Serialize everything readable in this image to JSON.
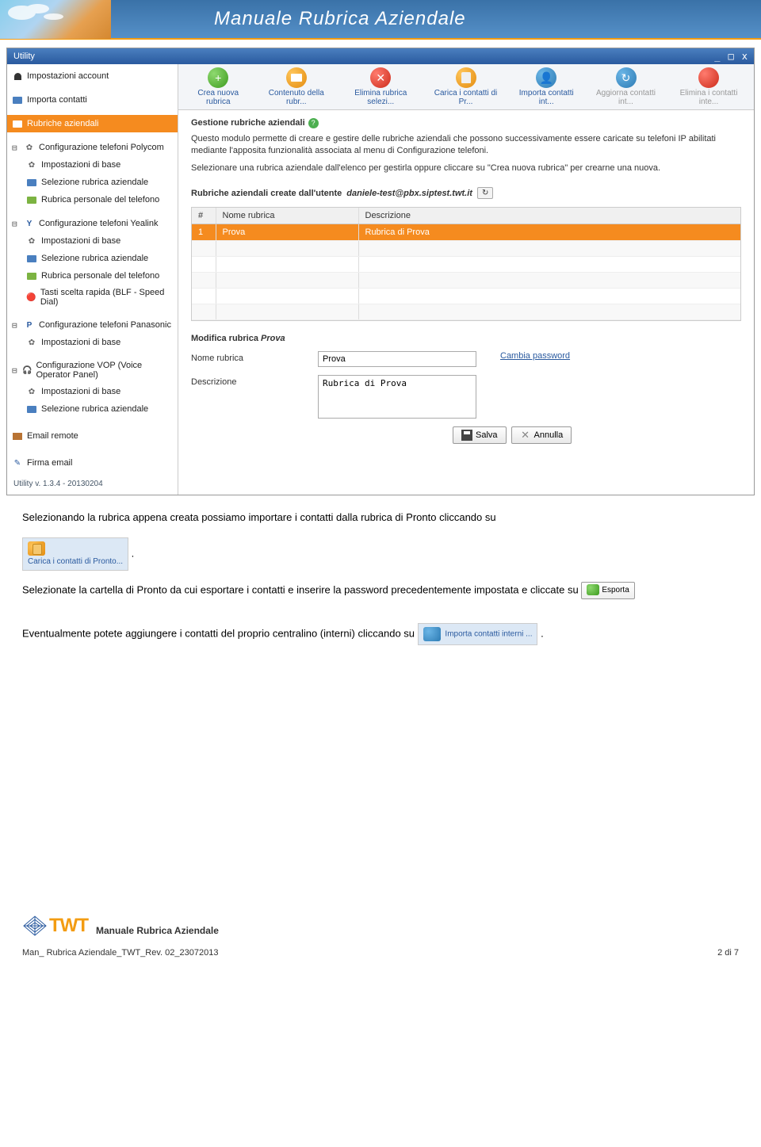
{
  "banner": {
    "title": "Manuale Rubrica Aziendale"
  },
  "window": {
    "title": "Utility",
    "buttons": {
      "min": "_",
      "max": "□",
      "close": "x"
    }
  },
  "sidebar": {
    "account": "Impostazioni account",
    "import": "Importa contatti",
    "rubriche": "Rubriche aziendali",
    "polycom": {
      "title": "Configurazione telefoni Polycom",
      "items": [
        "Impostazioni di base",
        "Selezione rubrica aziendale",
        "Rubrica personale del telefono"
      ]
    },
    "yealink": {
      "title": "Configurazione telefoni Yealink",
      "items": [
        "Impostazioni di base",
        "Selezione rubrica aziendale",
        "Rubrica personale del telefono",
        "Tasti scelta rapida (BLF - Speed Dial)"
      ]
    },
    "panasonic": {
      "title": "Configurazione telefoni Panasonic",
      "items": [
        "Impostazioni di base"
      ]
    },
    "vop": {
      "title": "Configurazione VOP (Voice Operator Panel)",
      "items": [
        "Impostazioni di base",
        "Selezione rubrica aziendale"
      ]
    },
    "email_remote": "Email remote",
    "firma": "Firma email",
    "version": "Utility v. 1.3.4 - 20130204"
  },
  "toolbar": {
    "items": [
      {
        "label": "Crea nuova rubrica",
        "cls": "ti-green",
        "glyph": "+"
      },
      {
        "label": "Contenuto della rubr...",
        "cls": "ti-orange",
        "glyph": ""
      },
      {
        "label": "Elimina rubrica selezi...",
        "cls": "ti-red",
        "glyph": "✕"
      },
      {
        "label": "Carica i contatti di Pr...",
        "cls": "ti-db",
        "glyph": ""
      },
      {
        "label": "Importa contatti int...",
        "cls": "ti-ref",
        "glyph": "👤"
      },
      {
        "label": "Aggiorna contatti int...",
        "cls": "ti-ref",
        "glyph": "↻",
        "disabled": true
      },
      {
        "label": "Elimina i contatti inte...",
        "cls": "ti-del",
        "glyph": "",
        "disabled": true
      }
    ]
  },
  "content": {
    "heading": "Gestione rubriche aziendali",
    "p1": "Questo modulo permette di creare e gestire delle rubriche aziendali che possono successivamente essere caricate su telefoni IP abilitati mediante l'apposita funzionalità associata al menu di Configurazione telefoni.",
    "p2": "Selezionare una rubrica aziendale dall'elenco per gestirla oppure cliccare su \"Crea nuova rubrica\" per crearne una nuova.",
    "listhdr_prefix": "Rubriche aziendali create dall'utente",
    "listhdr_user": "daniele-test@pbx.siptest.twt.it",
    "refresh": "↻",
    "table": {
      "cols": [
        "#",
        "Nome rubrica",
        "Descrizione"
      ],
      "rows": [
        {
          "num": "1",
          "name": "Prova",
          "desc": "Rubrica di Prova",
          "selected": true
        }
      ]
    },
    "edit": {
      "heading_prefix": "Modifica rubrica",
      "heading_name": "Prova",
      "name_label": "Nome rubrica",
      "name_value": "Prova",
      "desc_label": "Descrizione",
      "desc_value": "Rubrica di Prova",
      "change_pw": "Cambia password",
      "save": "Salva",
      "cancel": "Annulla"
    }
  },
  "doc": {
    "p1": "Selezionando la rubrica appena creata possiamo importare i contatti dalla rubrica di Pronto cliccando su",
    "inline1": "Carica i contatti di Pronto...",
    "p2a": "Selezionate la cartella di Pronto da cui esportare i contatti e inserire la password precedentemente",
    "p2b": "impostata e cliccate su",
    "inline2": "Esporta",
    "p3": "Eventualmente potete aggiungere i contatti del proprio centralino (interni) cliccando su",
    "inline3": "Importa contatti interni ..."
  },
  "footer": {
    "brand": "TWT",
    "title": "Manuale Rubrica Aziendale",
    "docref": "Man_ Rubrica Aziendale_TWT_Rev. 02_23072013",
    "page": "2 di 7"
  }
}
